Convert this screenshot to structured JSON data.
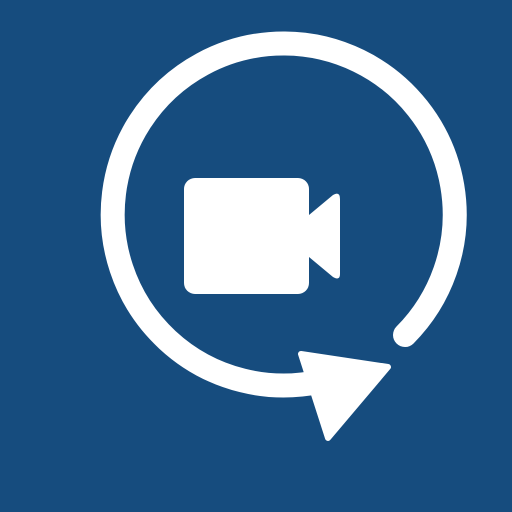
{
  "icon": {
    "name": "video-replay-app-icon",
    "background_color": "#164C7E",
    "foreground_color": "#FFFFFF",
    "glyphs": [
      "circular-arrow-icon",
      "video-camera-icon"
    ]
  }
}
